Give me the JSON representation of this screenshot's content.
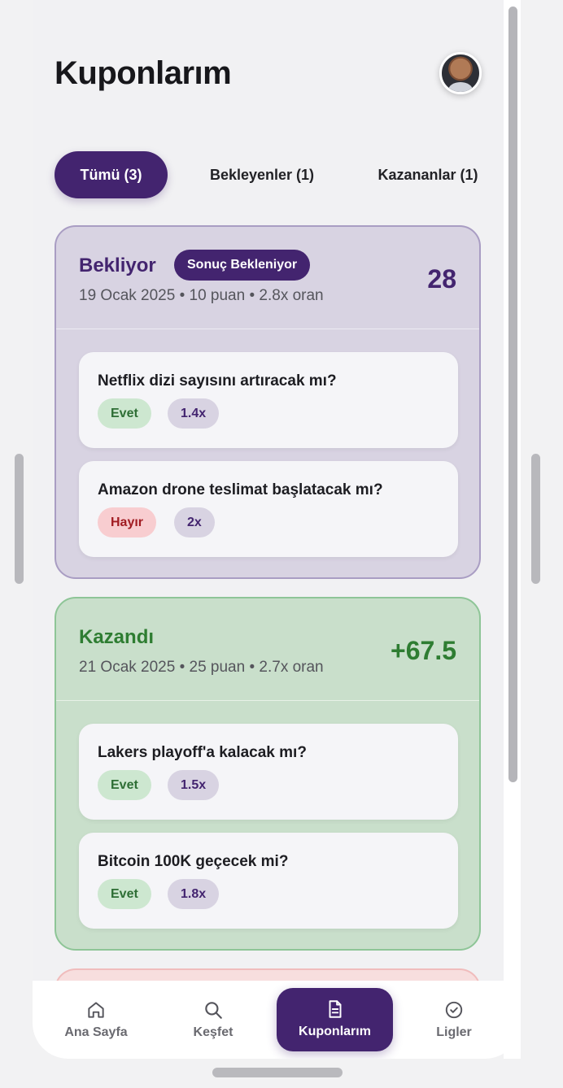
{
  "header": {
    "title": "Kuponlarım"
  },
  "tabs": [
    {
      "label": "Tümü (3)",
      "active": true
    },
    {
      "label": "Bekleyenler (1)",
      "active": false
    },
    {
      "label": "Kazananlar (1)",
      "active": false
    }
  ],
  "coupons": [
    {
      "status": "Bekliyor",
      "badge": "Sonuç Bekleniyor",
      "meta": "19 Ocak 2025 • 10 puan • 2.8x oran",
      "amount": "28",
      "bets": [
        {
          "question": "Netflix dizi sayısını artıracak mı?",
          "choice": "Evet",
          "odds": "1.4x"
        },
        {
          "question": "Amazon drone teslimat başlatacak mı?",
          "choice": "Hayır",
          "odds": "2x"
        }
      ]
    },
    {
      "status": "Kazandı",
      "meta": "21 Ocak 2025 • 25 puan • 2.7x oran",
      "amount": "+67.5",
      "bets": [
        {
          "question": "Lakers playoff'a kalacak mı?",
          "choice": "Evet",
          "odds": "1.5x"
        },
        {
          "question": "Bitcoin 100K geçecek mi?",
          "choice": "Evet",
          "odds": "1.8x"
        }
      ]
    }
  ],
  "nav": [
    {
      "label": "Ana Sayfa",
      "icon": "home-icon",
      "active": false
    },
    {
      "label": "Keşfet",
      "icon": "search-icon",
      "active": false
    },
    {
      "label": "Kuponlarım",
      "icon": "document-icon",
      "active": true
    },
    {
      "label": "Ligler",
      "icon": "badge-check-icon",
      "active": false
    }
  ],
  "colors": {
    "accent": "#43246f",
    "win": "#2e7d32",
    "lose": "#a11c22"
  }
}
